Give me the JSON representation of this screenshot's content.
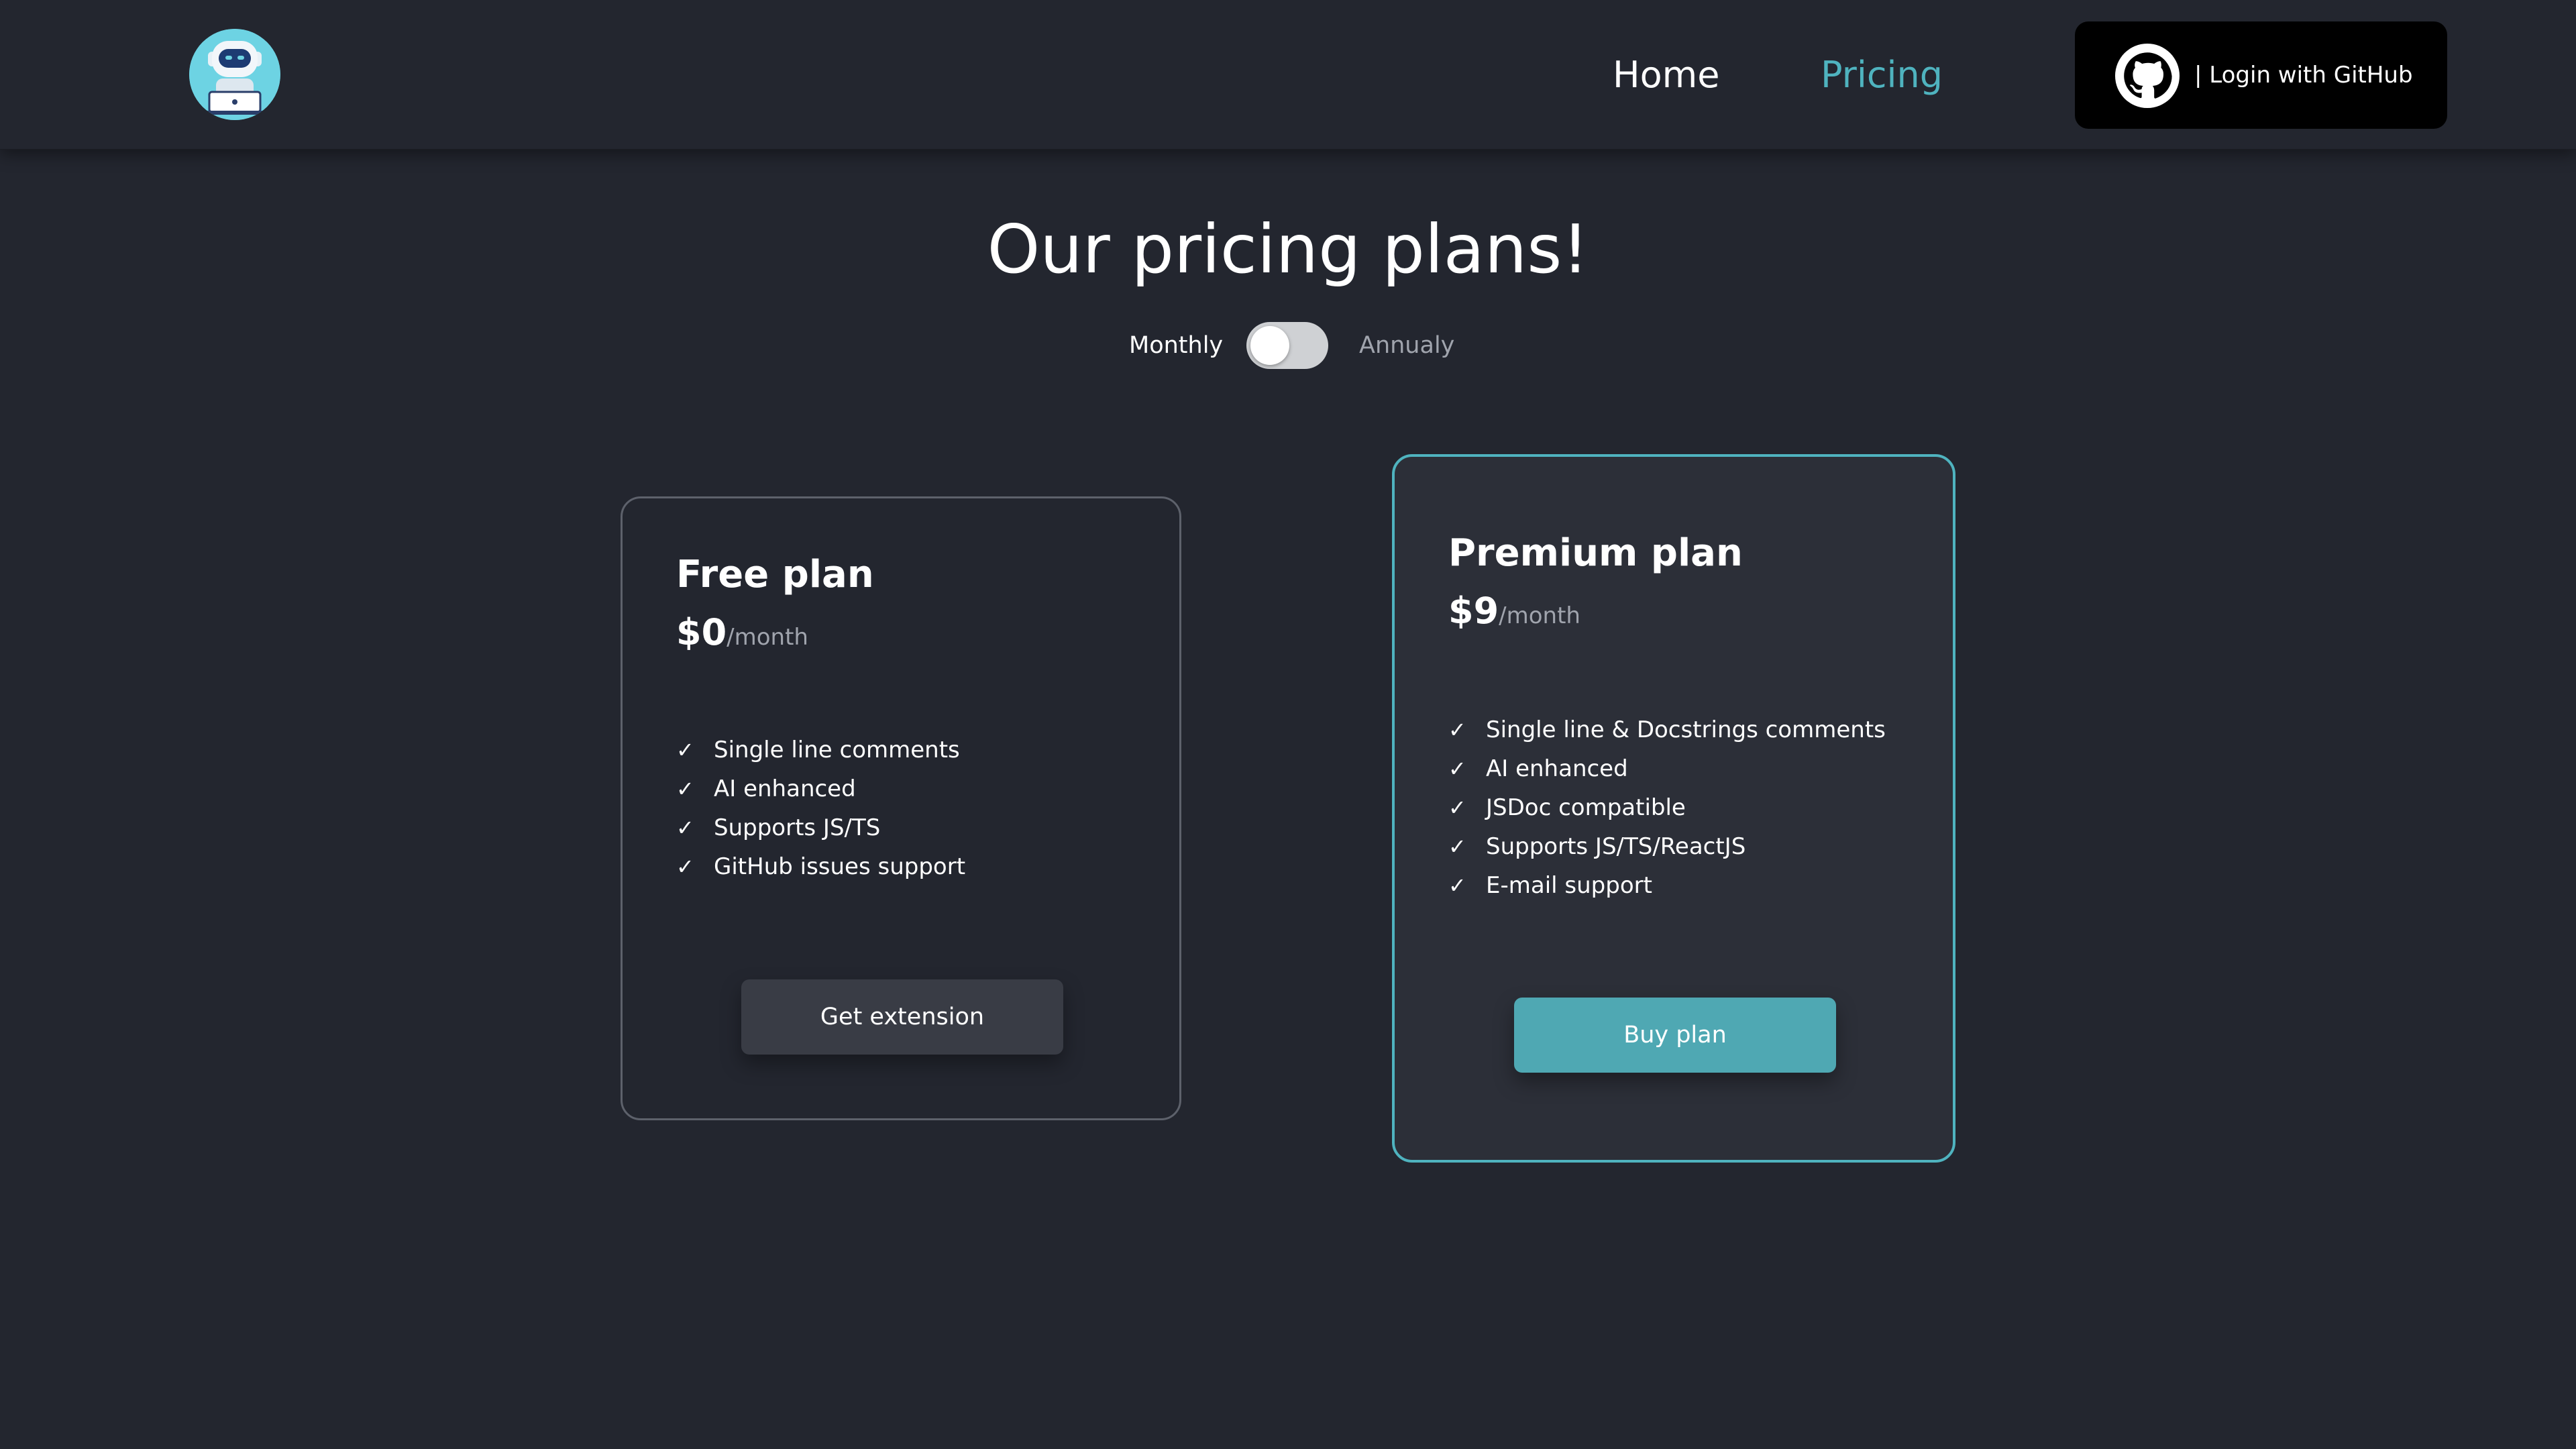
{
  "nav": {
    "logo_alt": "robot mascot",
    "home_label": "Home",
    "pricing_label": "Pricing",
    "login_label": "| Login with GitHub"
  },
  "page": {
    "title": "Our pricing plans!"
  },
  "billing": {
    "monthly_label": "Monthly",
    "annual_label": "Annualy",
    "annual_selected": false
  },
  "plans": [
    {
      "name": "Free plan",
      "price": "$0",
      "period": "/month",
      "features": [
        "Single line comments",
        "AI enhanced",
        "Supports JS/TS",
        "GitHub issues support"
      ],
      "cta": "Get extension",
      "check_glyph": "✓"
    },
    {
      "name": "Premium plan",
      "price": "$9",
      "period": "/month",
      "features": [
        "Single line & Docstrings comments",
        "AI enhanced",
        "JSDoc compatible",
        "Supports JS/TS/ReactJS",
        "E-mail support"
      ],
      "cta": "Buy plan",
      "check_glyph": "✓"
    }
  ],
  "colors": {
    "background": "#23262f",
    "accent": "#4fb3bf",
    "button_premium": "#4fa8b3",
    "button_free": "#393c45",
    "login_bg": "#000000"
  },
  "icons": {
    "logo": "robot-logo-icon",
    "github": "github-icon",
    "check": "check-icon"
  }
}
